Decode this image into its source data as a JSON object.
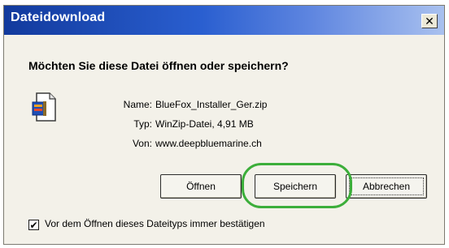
{
  "dialog": {
    "title": "Dateidownload",
    "close_glyph": "✕",
    "question": "Möchten Sie diese Datei öffnen oder speichern?",
    "file": {
      "icon": "zip-file-icon",
      "name_label": "Name:",
      "name_value": "BlueFox_Installer_Ger.zip",
      "type_label": "Typ:",
      "type_value": "WinZip-Datei, 4,91 MB",
      "from_label": "Von:",
      "from_value": "www.deepbluemarine.ch"
    },
    "buttons": {
      "open": "Öffnen",
      "save": "Speichern",
      "cancel": "Abbrechen"
    },
    "checkbox": {
      "checked": true,
      "check_glyph": "✔",
      "label": "Vor dem Öffnen dieses Dateityps immer bestätigen"
    },
    "highlight_color": "#3cae3a"
  }
}
